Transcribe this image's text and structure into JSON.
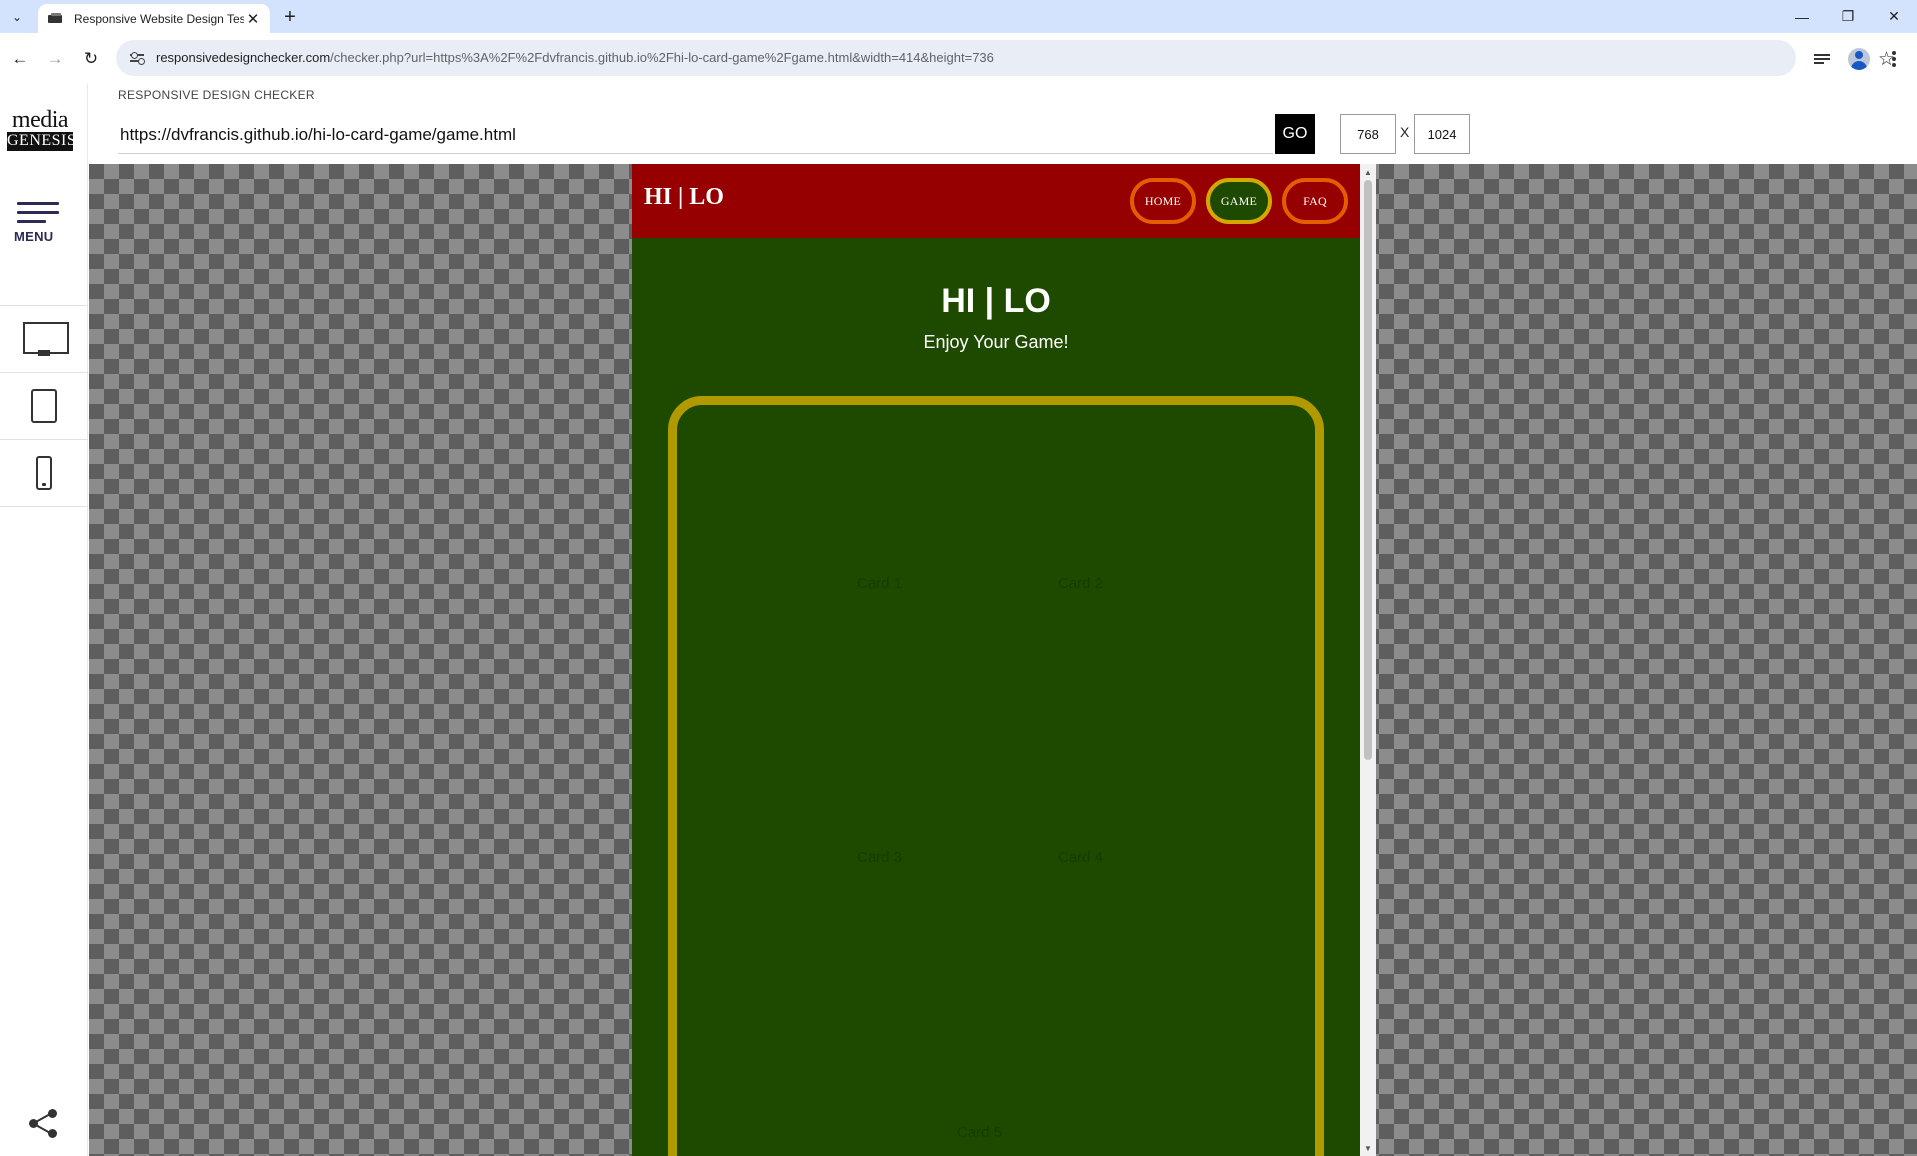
{
  "browser": {
    "tab_title": "Responsive Website Design Tes",
    "new_tab_glyph": "+",
    "url_host": "responsivedesignchecker.com",
    "url_rest": "/checker.php?url=https%3A%2F%2Fdvfrancis.github.io%2Fhi-lo-card-game%2Fgame.html&width=414&height=736"
  },
  "checker": {
    "brand_top": "media",
    "brand_bottom": "GENESIS",
    "menu_label": "MENU",
    "heading": "RESPONSIVE DESIGN CHECKER",
    "url_value": "https://dvfrancis.github.io/hi-lo-card-game/game.html",
    "go_label": "GO",
    "width_value": "768",
    "x_label": "X",
    "height_value": "1024"
  },
  "site": {
    "logo": "HI | LO",
    "nav": [
      {
        "label": "HOME",
        "active": false
      },
      {
        "label": "GAME",
        "active": true
      },
      {
        "label": "FAQ",
        "active": false
      }
    ],
    "heading": "HI | LO",
    "subheading": "Enjoy Your Game!",
    "cards": [
      "Card 1",
      "Card 2",
      "Card 3",
      "Card 4",
      "Card 5"
    ]
  },
  "colors": {
    "site_nav_bg": "#960000",
    "site_bg": "#1e4a00",
    "board_border": "#b09a00",
    "nav_button_border": "#e65c00",
    "nav_button_active_border": "#d4a800"
  },
  "icons": {
    "tab_list": "chevron-down-icon",
    "back": "arrow-left-icon",
    "forward": "arrow-right-icon",
    "reload": "reload-icon",
    "site_info": "tune-icon",
    "bookmark": "star-outline-icon",
    "media": "media-queue-icon",
    "profile": "person-icon",
    "more": "kebab-icon",
    "share": "share-icon"
  }
}
